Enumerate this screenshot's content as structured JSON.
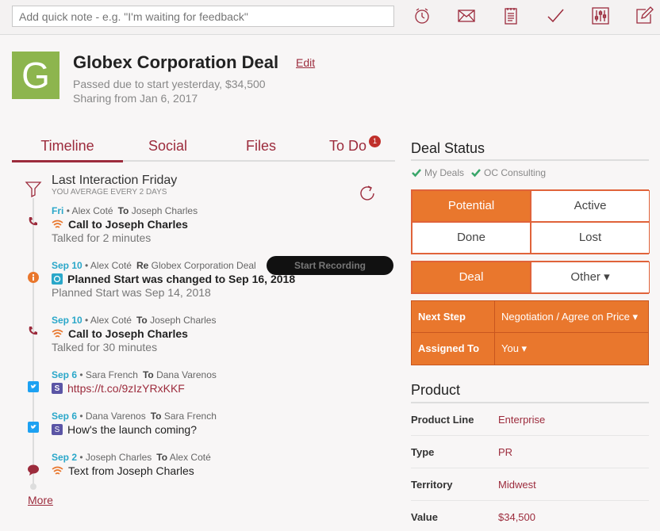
{
  "quick_note": {
    "placeholder": "Add quick note - e.g. \"I'm waiting for feedback\""
  },
  "toolbar": {
    "icons": [
      "alarm-icon",
      "mail-icon",
      "notepad-icon",
      "checkmark-icon",
      "sliders-icon",
      "edit-icon"
    ]
  },
  "header": {
    "logo_letter": "G",
    "title": "Globex Corporation Deal",
    "edit_label": "Edit",
    "status_line": "Passed due to start yesterday, $34,500",
    "sharing_line": "Sharing from Jan 6, 2017"
  },
  "tabs": [
    {
      "label": "Timeline"
    },
    {
      "label": "Social"
    },
    {
      "label": "Files"
    },
    {
      "label": "To Do"
    }
  ],
  "todo_badge": "1",
  "timeline": {
    "heading": "Last Interaction Friday",
    "subheading": "YOU AVERAGE EVERY 2 DAYS",
    "more_label": "More",
    "recording_label": "Start Recording",
    "entries": [
      {
        "date": "Fri",
        "from": "• Alex Coté",
        "kw": "To",
        "to": "Joseph Charles",
        "title": "Call to Joseph Charles",
        "sub": "Talked for 2 minutes"
      },
      {
        "date": "Sep 10",
        "from": "• Alex Coté",
        "kw": "Re",
        "to": "Globex Corporation Deal",
        "title": "Planned Start was changed to Sep 16, 2018",
        "sub": "Planned Start was Sep 14, 2018"
      },
      {
        "date": "Sep 10",
        "from": "• Alex Coté",
        "kw": "To",
        "to": "Joseph Charles",
        "title": "Call to Joseph Charles",
        "sub": "Talked for 30 minutes"
      },
      {
        "date": "Sep 6",
        "from": "• Sara French",
        "kw": "To",
        "to": "Dana Varenos",
        "title": "https://t.co/9zIzYRxKKF"
      },
      {
        "date": "Sep 6",
        "from": "• Dana Varenos",
        "kw": "To",
        "to": "Sara French",
        "title": "How's the launch coming?"
      },
      {
        "date": "Sep 2",
        "from": "• Joseph Charles",
        "kw": "To",
        "to": "Alex Coté",
        "title": "Text from Joseph Charles"
      }
    ]
  },
  "deal_status": {
    "title": "Deal Status",
    "tags": [
      "My Deals",
      "OC Consulting"
    ],
    "stages": [
      "Potential",
      "Active",
      "Done",
      "Lost"
    ],
    "types": [
      "Deal",
      "Other ▾"
    ],
    "next_step_label": "Next Step",
    "next_step_value": "Negotiation / Agree on Price ▾",
    "assigned_label": "Assigned To",
    "assigned_value": "You ▾"
  },
  "product": {
    "title": "Product",
    "rows": [
      {
        "key": "Product Line",
        "value": "Enterprise"
      },
      {
        "key": "Type",
        "value": "PR"
      },
      {
        "key": "Territory",
        "value": "Midwest"
      },
      {
        "key": "Value",
        "value": "$34,500"
      }
    ]
  },
  "colors": {
    "accent": "#9c2b3c",
    "orange": "#e9772d",
    "logo": "#8db54e",
    "date": "#2aa7c9"
  }
}
